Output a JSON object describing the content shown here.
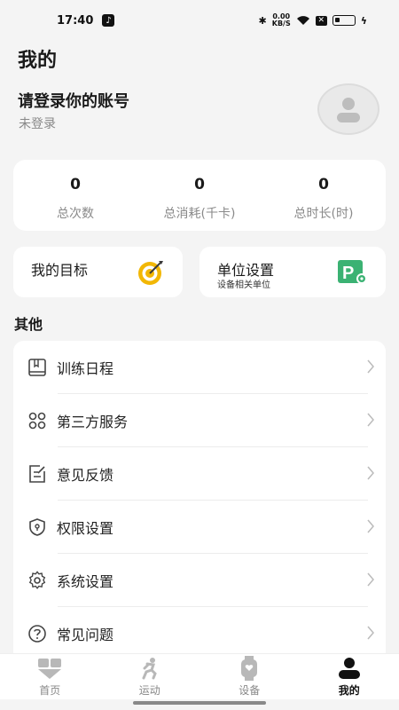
{
  "status_bar": {
    "time": "17:40",
    "speed_top": "0.00",
    "speed_bottom": "KB/S",
    "icons": [
      "tiktok-icon",
      "bluetooth-icon",
      "wifi-icon",
      "sim-x-icon",
      "battery-icon",
      "charging-icon"
    ]
  },
  "page": {
    "title": "我的"
  },
  "login": {
    "title": "请登录你的账号",
    "status": "未登录"
  },
  "stats": [
    {
      "value": "0",
      "label": "总次数"
    },
    {
      "value": "0",
      "label": "总消耗(千卡)"
    },
    {
      "value": "0",
      "label": "总时长(时)"
    }
  ],
  "tiles": {
    "goal": {
      "title": "我的目标",
      "icon": "target-icon"
    },
    "unit": {
      "title": "单位设置",
      "subtitle": "设备相关单位",
      "icon": "parking-settings-icon"
    }
  },
  "section": {
    "other": "其他"
  },
  "menu": [
    {
      "label": "训练日程",
      "icon": "calendar-book-icon"
    },
    {
      "label": "第三方服务",
      "icon": "grid-icon"
    },
    {
      "label": "意见反馈",
      "icon": "feedback-edit-icon"
    },
    {
      "label": "权限设置",
      "icon": "shield-icon"
    },
    {
      "label": "系统设置",
      "icon": "gear-icon"
    },
    {
      "label": "常见问题",
      "icon": "question-icon"
    }
  ],
  "nav": [
    {
      "label": "首页",
      "icon": "home-icon",
      "active": false
    },
    {
      "label": "运动",
      "icon": "run-icon",
      "active": false
    },
    {
      "label": "设备",
      "icon": "watch-icon",
      "active": false
    },
    {
      "label": "我的",
      "icon": "profile-icon",
      "active": true
    }
  ],
  "colors": {
    "accent_yellow": "#f2b705",
    "accent_green": "#3bb273",
    "background": "#f4f4f4"
  }
}
